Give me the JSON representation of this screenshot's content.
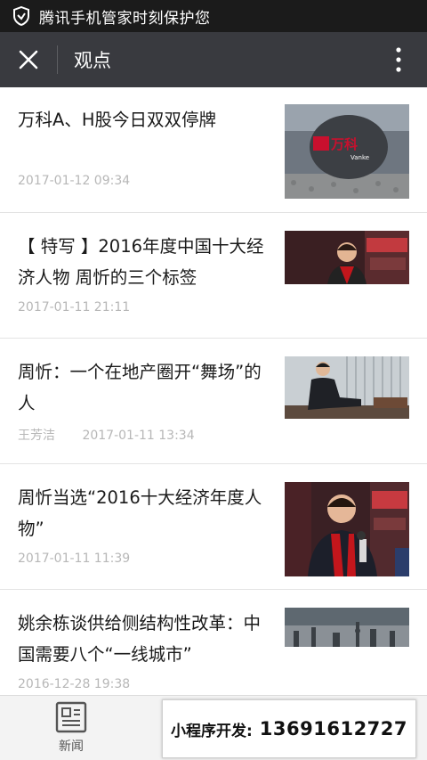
{
  "status_bar": {
    "text": "腾讯手机管家时刻保护您",
    "icon": "shield-icon"
  },
  "title_bar": {
    "title": "观点",
    "close_icon": "close-icon",
    "more_icon": "more-vertical-icon"
  },
  "articles": [
    {
      "title": "万科A、H股今日双双停牌",
      "author": "",
      "date": "2017-01-12 09:34",
      "thumb": "vanke-logo-sign"
    },
    {
      "title": "【 特写 】2016年度中国十大经济人物 周忻的三个标签",
      "author": "",
      "date": "2017-01-11 21:11",
      "thumb": "speaker-photo"
    },
    {
      "title": "周忻：一个在地产圈开“舞场”的人",
      "author": "王芳洁",
      "date": "2017-01-11 13:34",
      "thumb": "seated-man-photo"
    },
    {
      "title": "周忻当选“2016十大经济年度人物”",
      "author": "",
      "date": "2017-01-11 11:39",
      "thumb": "speaker-microphone-photo"
    },
    {
      "title": "姚余栋谈供给侧结构性改革：中国需要八个“一线城市”",
      "author": "",
      "date": "2016-12-28 19:38",
      "thumb": "city-skyline-photo"
    }
  ],
  "thumb_logo": {
    "brand_cn": "万科",
    "brand_en": "Vanke",
    "accent": "#c8102e"
  },
  "bottom_bar": {
    "news_label": "新闻",
    "news_icon": "newspaper-icon",
    "promo_label": "小程序开发:",
    "promo_phone": "13691612727"
  },
  "colors": {
    "status_bar": "#1b1b1b",
    "title_bar": "#393a3f",
    "meta_text": "#b7b7b7"
  }
}
